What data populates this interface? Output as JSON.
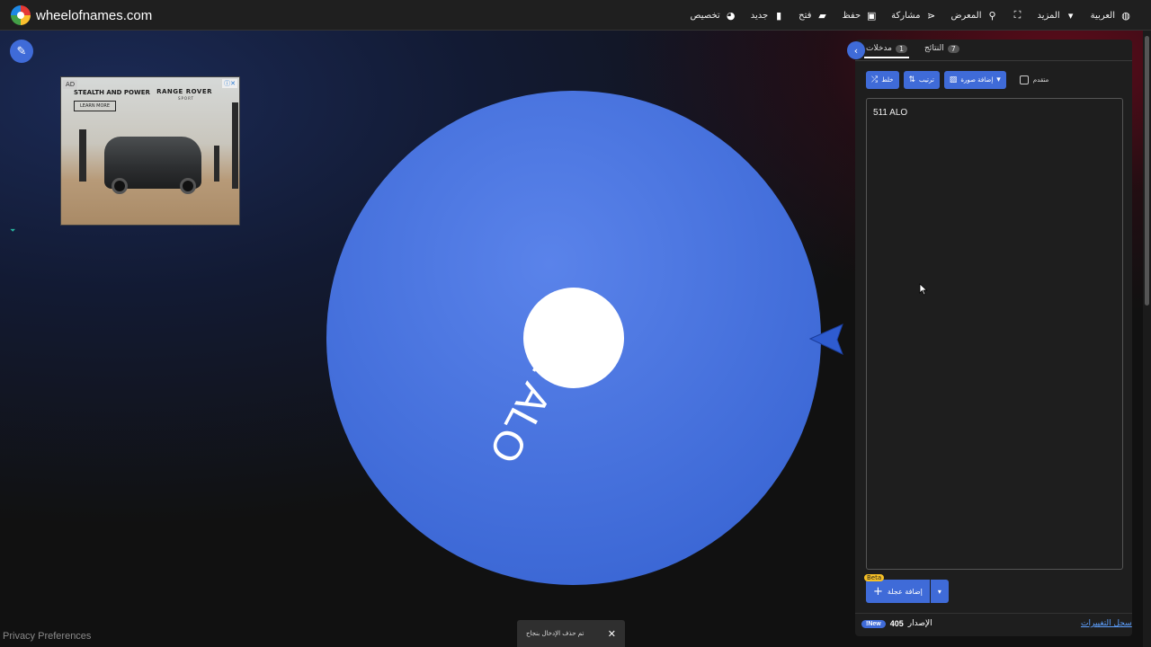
{
  "brand": {
    "name": "wheelofnames.com"
  },
  "nav": [
    {
      "label": "العربية",
      "icon": "globe-icon"
    },
    {
      "label": "المزيد",
      "icon": "chevron-down-icon"
    },
    {
      "label": "",
      "icon": "fullscreen-icon"
    },
    {
      "label": "المعرض",
      "icon": "search-icon"
    },
    {
      "label": "مشاركة",
      "icon": "share-icon"
    },
    {
      "label": "حفظ",
      "icon": "save-icon"
    },
    {
      "label": "فتح",
      "icon": "folder-icon"
    },
    {
      "label": "جديد",
      "icon": "file-icon"
    },
    {
      "label": "تخصيص",
      "icon": "palette-icon"
    }
  ],
  "ad": {
    "tag": "AD",
    "headline": "STEALTH AND POWER",
    "brand": "RANGE ROVER",
    "brand_sub": "SPORT",
    "cta": "LEARN MORE"
  },
  "wheel": {
    "segment_label": "511 ALO",
    "color": "#3f6bd8"
  },
  "tabs": {
    "entries": {
      "label": "مدخلات",
      "count": "1"
    },
    "results": {
      "label": "النتائج",
      "count": "7"
    }
  },
  "toolbar": {
    "shuffle": "خلط",
    "sort": "ترتيب",
    "add_image": "إضافة صورة",
    "advanced": "متقدم"
  },
  "entries_text": "511 ALO",
  "add_wheel": {
    "label": "إضافة عجلة",
    "beta": "Beta"
  },
  "footer": {
    "version_label": "الإصدار",
    "version_number": "405",
    "new_badge": "New!",
    "changelog": "سجل التغييرات"
  },
  "privacy": "Privacy Preferences",
  "toast": {
    "text": "تم حذف الإدخال بنجاح"
  }
}
